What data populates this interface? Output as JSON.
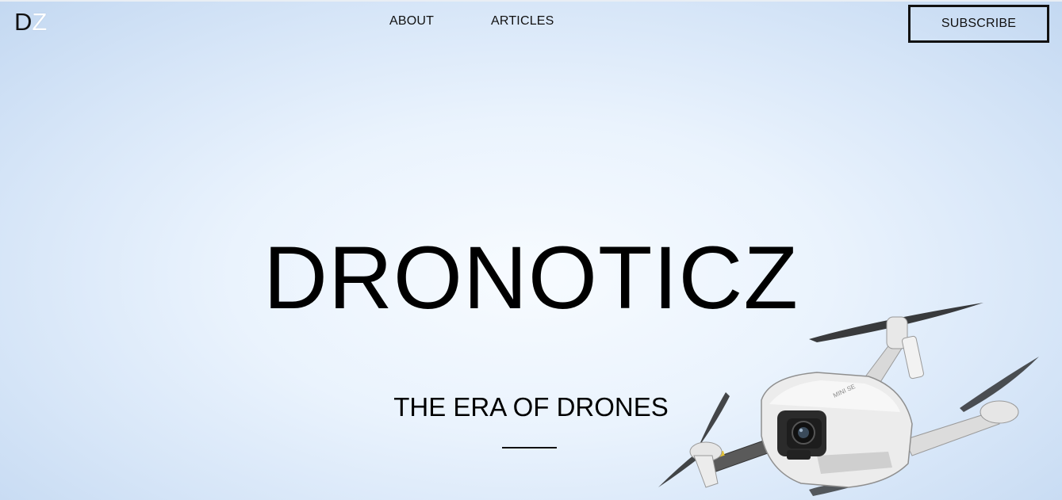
{
  "header": {
    "logo": {
      "letter_1": "D",
      "letter_2": "Z"
    },
    "nav": [
      {
        "label": "ABOUT"
      },
      {
        "label": "ARTICLES"
      }
    ],
    "subscribe_label": "SUBSCRIBE"
  },
  "hero": {
    "title": "DRONOTICZ",
    "subtitle": "THE ERA OF DRONES",
    "drone_label": "MINI SE"
  },
  "colors": {
    "sky_center": "#f7fbff",
    "sky_edge": "#c3d8f1",
    "text": "#000000"
  }
}
